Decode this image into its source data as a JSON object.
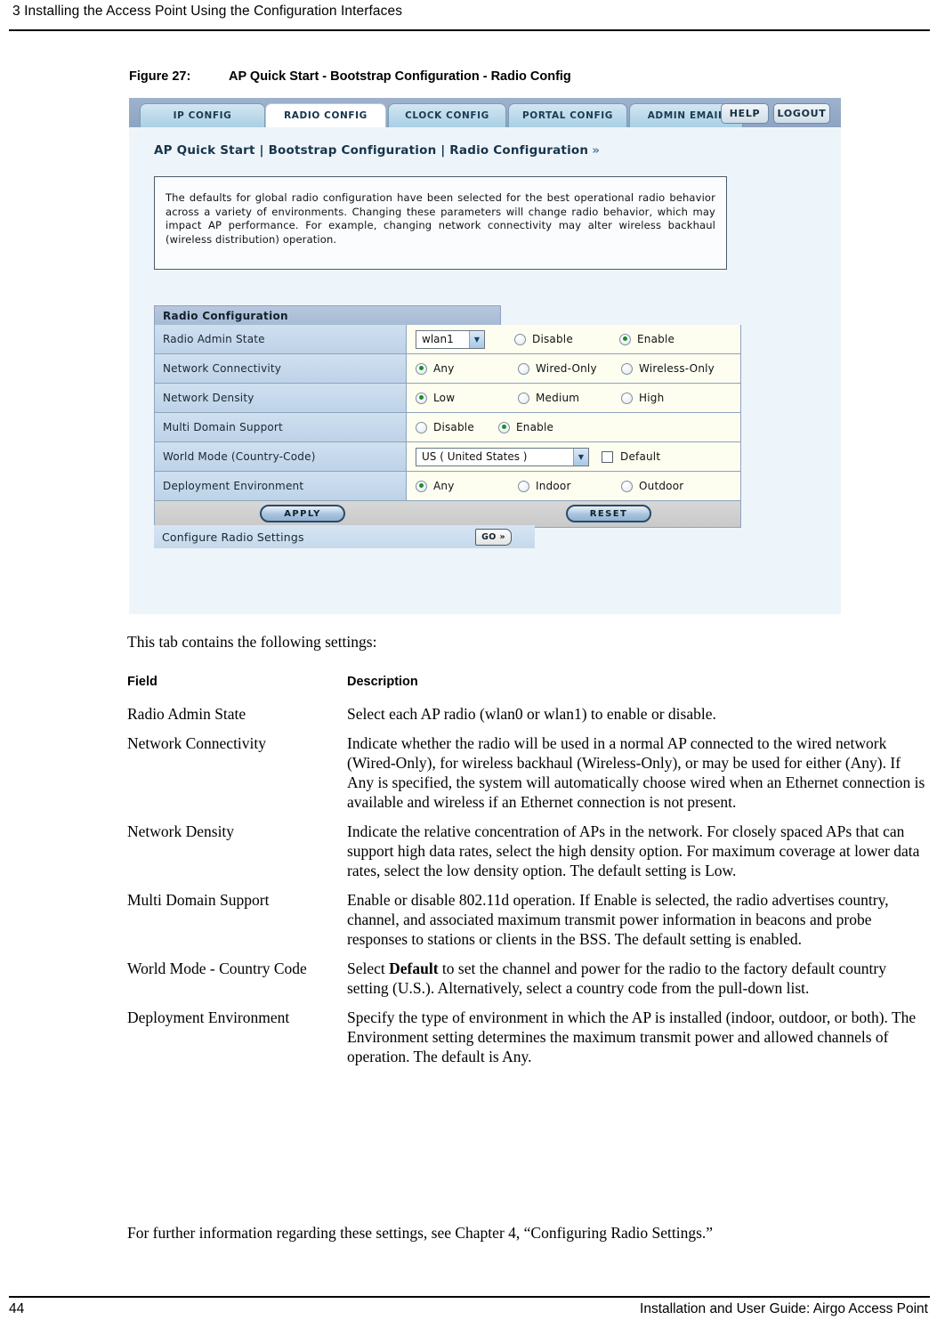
{
  "page": {
    "running_head": "3  Installing the Access Point Using the Configuration Interfaces",
    "footer_page_number": "44",
    "footer_title": "Installation and User Guide: Airgo Access Point"
  },
  "figure": {
    "number": "Figure 27:",
    "title": "AP Quick Start - Bootstrap Configuration - Radio Config"
  },
  "screenshot": {
    "tabs": [
      {
        "label": "IP CONFIG",
        "active": false
      },
      {
        "label": "RADIO CONFIG",
        "active": true
      },
      {
        "label": "CLOCK CONFIG",
        "active": false
      },
      {
        "label": "PORTAL CONFIG",
        "active": false
      },
      {
        "label": "ADMIN EMAIL",
        "active": false
      }
    ],
    "top_buttons": [
      {
        "label": "HELP"
      },
      {
        "label": "LOGOUT"
      }
    ],
    "breadcrumb": "AP Quick Start | Bootstrap Configuration | Radio Configuration",
    "breadcrumb_chevron": "»",
    "note": "The defaults for global radio configuration have been selected for the best operational radio behavior across a variety of environments. Changing these parameters will change radio behavior, which may impact AP performance. For example, changing network connectivity may alter wireless backhaul (wireless distribution) operation.",
    "section_title": "Radio Configuration",
    "rows": {
      "radio_admin_state": {
        "label": "Radio Admin State",
        "select_value": "wlan1",
        "options": [
          {
            "label": "Disable",
            "selected": false
          },
          {
            "label": "Enable",
            "selected": true
          }
        ]
      },
      "network_connectivity": {
        "label": "Network Connectivity",
        "options": [
          {
            "label": "Any",
            "selected": true
          },
          {
            "label": "Wired-Only",
            "selected": false
          },
          {
            "label": "Wireless-Only",
            "selected": false
          }
        ]
      },
      "network_density": {
        "label": "Network Density",
        "options": [
          {
            "label": "Low",
            "selected": true
          },
          {
            "label": "Medium",
            "selected": false
          },
          {
            "label": "High",
            "selected": false
          }
        ]
      },
      "multi_domain_support": {
        "label": "Multi Domain Support",
        "options": [
          {
            "label": "Disable",
            "selected": false
          },
          {
            "label": "Enable",
            "selected": true
          }
        ]
      },
      "world_mode": {
        "label": "World Mode (Country-Code)",
        "select_value": "US ( United States )",
        "checkbox_label": "Default",
        "checkbox_checked": false
      },
      "deployment_environment": {
        "label": "Deployment Environment",
        "options": [
          {
            "label": "Any",
            "selected": true
          },
          {
            "label": "Indoor",
            "selected": false
          },
          {
            "label": "Outdoor",
            "selected": false
          }
        ]
      }
    },
    "apply_label": "APPLY",
    "reset_label": "RESET",
    "go_link_label": "Configure Radio Settings",
    "go_button_label": "GO »"
  },
  "body": {
    "intro": "This tab contains the following settings:",
    "closing": "For further information regarding these settings, see Chapter 4,  “Configuring Radio Settings.”",
    "table": {
      "headers": {
        "field": "Field",
        "description": "Description"
      },
      "rows": [
        {
          "field": "Radio Admin State",
          "description": "Select each AP radio (wlan0 or wlan1) to enable or disable."
        },
        {
          "field": "Network Connectivity",
          "description": "Indicate whether the radio will be used in a normal AP connected to the wired network (Wired-Only), for wireless backhaul (Wireless-Only), or may be used for either (Any). If Any is specified, the system will automatically choose wired when an Ethernet connection is available and wireless if an Ethernet connection is not present."
        },
        {
          "field": "Network Density",
          "description": "Indicate the relative concentration of APs in the network. For closely spaced APs that can support high data rates, select the high density option. For maximum coverage at lower data rates, select the low density option. The default setting is Low."
        },
        {
          "field": "Multi Domain Support",
          "description": "Enable or disable 802.11d operation. If Enable is selected, the radio advertises country, channel, and associated maximum transmit power information in beacons and probe responses to stations or clients in the BSS. The default setting is enabled."
        },
        {
          "field": "World Mode - Country Code",
          "description_pre": "Select ",
          "description_bold": "Default",
          "description_post": " to set the channel and power for the radio to the factory default country setting (U.S.). Alternatively, select a country code from the pull-down list."
        },
        {
          "field": "Deployment Environment",
          "description": "Specify the type of environment in which the AP is installed (indoor, outdoor, or both). The Environment setting determines the maximum transmit power and allowed channels of operation. The default is Any."
        }
      ]
    }
  }
}
